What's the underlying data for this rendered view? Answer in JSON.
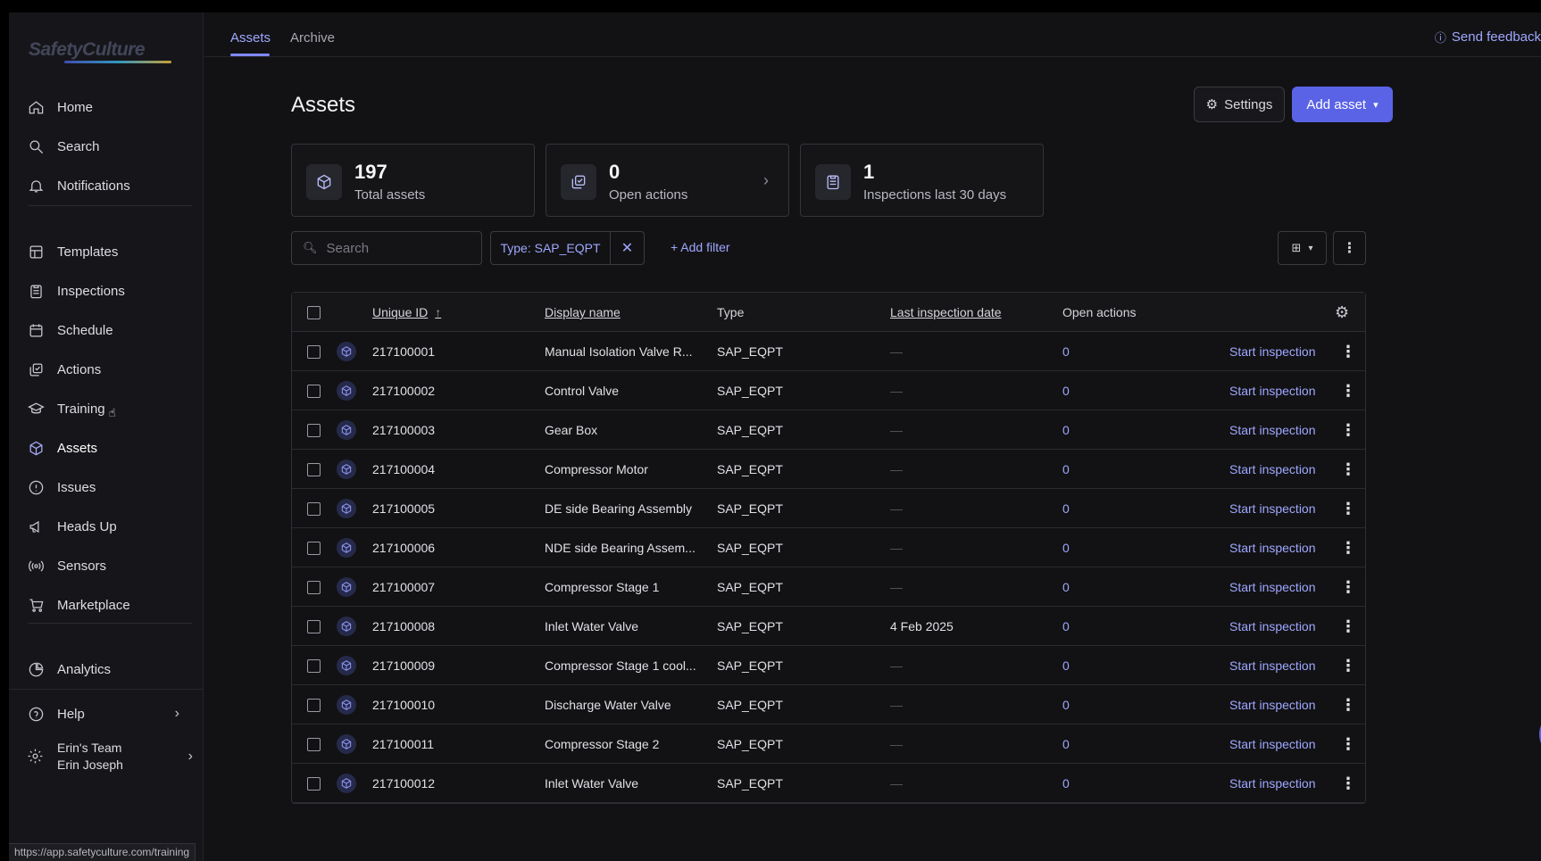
{
  "sidebar": {
    "logo": "SafetyCulture",
    "items": [
      {
        "label": "Home",
        "icon": "home-icon"
      },
      {
        "label": "Search",
        "icon": "search-icon"
      },
      {
        "label": "Notifications",
        "icon": "bell-icon"
      },
      {
        "label": "Templates",
        "icon": "template-icon"
      },
      {
        "label": "Inspections",
        "icon": "clipboard-icon"
      },
      {
        "label": "Schedule",
        "icon": "calendar-icon"
      },
      {
        "label": "Actions",
        "icon": "actions-icon"
      },
      {
        "label": "Training",
        "icon": "graduation-cap-icon"
      },
      {
        "label": "Assets",
        "icon": "cube-icon"
      },
      {
        "label": "Issues",
        "icon": "alert-icon"
      },
      {
        "label": "Heads Up",
        "icon": "megaphone-icon"
      },
      {
        "label": "Sensors",
        "icon": "sensor-icon"
      },
      {
        "label": "Marketplace",
        "icon": "cart-icon"
      },
      {
        "label": "Analytics",
        "icon": "pie-chart-icon"
      },
      {
        "label": "Help",
        "icon": "help-icon"
      }
    ],
    "user": {
      "team": "Erin's Team",
      "name": "Erin Joseph"
    },
    "status_url": "https://app.safetyculture.com/training"
  },
  "topbar": {
    "tabs": [
      "Assets",
      "Archive"
    ],
    "feedback": "Send feedback"
  },
  "page": {
    "title": "Assets",
    "settings_label": "Settings",
    "add_label": "Add asset"
  },
  "stats": [
    {
      "value": "197",
      "label": "Total assets"
    },
    {
      "value": "0",
      "label": "Open actions"
    },
    {
      "value": "1",
      "label": "Inspections last 30 days"
    }
  ],
  "filters": {
    "search_placeholder": "Search",
    "chip": "Type: SAP_EQPT",
    "add_filter": "+ Add filter"
  },
  "table": {
    "columns": [
      "Unique ID",
      "Display name",
      "Type",
      "Last inspection date",
      "Open actions"
    ],
    "action_label": "Start inspection",
    "rows": [
      {
        "id": "217100001",
        "name": "Manual Isolation Valve R...",
        "type": "SAP_EQPT",
        "last": "—",
        "open": "0"
      },
      {
        "id": "217100002",
        "name": "Control Valve",
        "type": "SAP_EQPT",
        "last": "—",
        "open": "0"
      },
      {
        "id": "217100003",
        "name": "Gear Box",
        "type": "SAP_EQPT",
        "last": "—",
        "open": "0"
      },
      {
        "id": "217100004",
        "name": "Compressor Motor",
        "type": "SAP_EQPT",
        "last": "—",
        "open": "0"
      },
      {
        "id": "217100005",
        "name": "DE side Bearing Assembly",
        "type": "SAP_EQPT",
        "last": "—",
        "open": "0"
      },
      {
        "id": "217100006",
        "name": "NDE side Bearing Assem...",
        "type": "SAP_EQPT",
        "last": "—",
        "open": "0"
      },
      {
        "id": "217100007",
        "name": "Compressor Stage 1",
        "type": "SAP_EQPT",
        "last": "—",
        "open": "0"
      },
      {
        "id": "217100008",
        "name": "Inlet Water Valve",
        "type": "SAP_EQPT",
        "last": "4 Feb 2025",
        "open": "0"
      },
      {
        "id": "217100009",
        "name": "Compressor Stage 1 cool...",
        "type": "SAP_EQPT",
        "last": "—",
        "open": "0"
      },
      {
        "id": "217100010",
        "name": "Discharge Water Valve",
        "type": "SAP_EQPT",
        "last": "—",
        "open": "0"
      },
      {
        "id": "217100011",
        "name": "Compressor Stage 2",
        "type": "SAP_EQPT",
        "last": "—",
        "open": "0"
      },
      {
        "id": "217100012",
        "name": "Inlet Water Valve",
        "type": "SAP_EQPT",
        "last": "—",
        "open": "0"
      }
    ]
  },
  "colors": {
    "accent": "#5a63e6",
    "link": "#9fa7ff",
    "background": "#121214"
  }
}
